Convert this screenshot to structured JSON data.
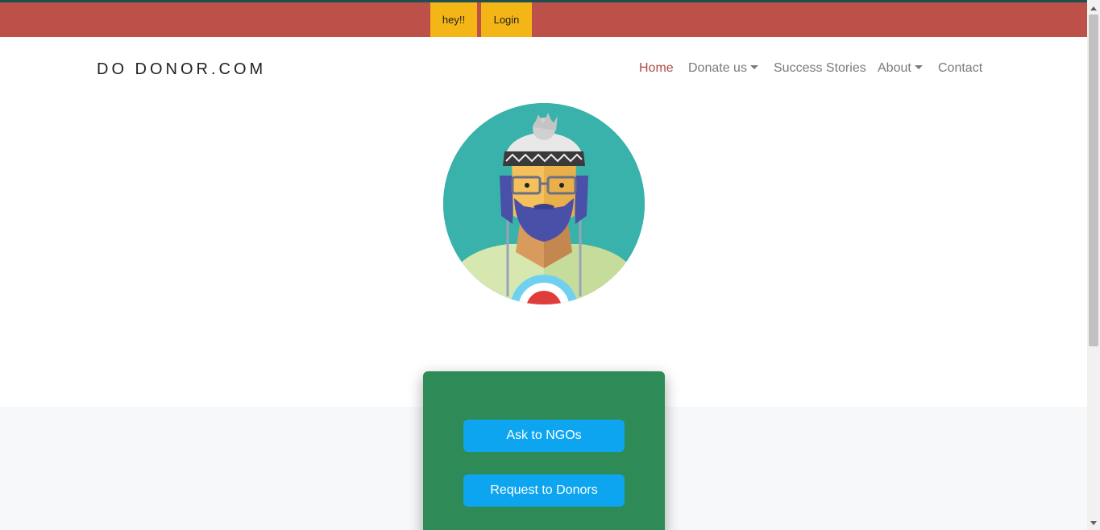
{
  "topbar": {
    "hey_label": "hey!!",
    "login_label": "Login"
  },
  "brand": "DO DONOR.COM",
  "nav": {
    "home": "Home",
    "donate": "Donate us",
    "stories": "Success Stories",
    "about": "About",
    "contact": "Contact"
  },
  "actions": {
    "ask_ngos": "Ask to NGOs",
    "request_donors": "Request to Donors"
  },
  "colors": {
    "topbar": "#bd5049",
    "top_buttons": "#f4b516",
    "nav_active": "#b04a45",
    "card": "#2e8b57",
    "action_button": "#0ea5f0"
  },
  "icons": {
    "avatar": "bearded-man-avatar",
    "dropdown": "caret-down-icon"
  }
}
